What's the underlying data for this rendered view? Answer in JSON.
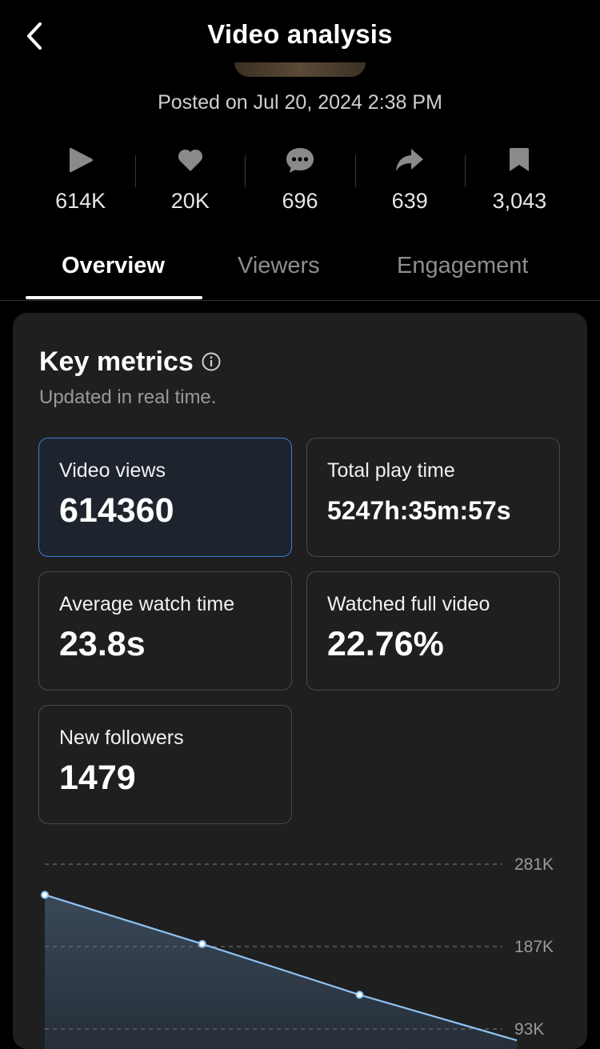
{
  "header": {
    "title": "Video analysis",
    "back_icon": "chevron-left-icon"
  },
  "posted": "Posted on Jul 20, 2024 2:38 PM",
  "stats": [
    {
      "icon": "play-icon",
      "value": "614K"
    },
    {
      "icon": "heart-icon",
      "value": "20K"
    },
    {
      "icon": "comment-icon",
      "value": "696"
    },
    {
      "icon": "share-icon",
      "value": "639"
    },
    {
      "icon": "bookmark-icon",
      "value": "3,043"
    }
  ],
  "tabs": [
    {
      "label": "Overview",
      "active": true
    },
    {
      "label": "Viewers",
      "active": false
    },
    {
      "label": "Engagement",
      "active": false
    }
  ],
  "key_metrics": {
    "title": "Key metrics",
    "subtitle": "Updated in real time.",
    "items": [
      {
        "label": "Video views",
        "value": "614360",
        "selected": true
      },
      {
        "label": "Total play time",
        "value": "5247h:35m:57s"
      },
      {
        "label": "Average watch time",
        "value": "23.8s"
      },
      {
        "label": "Watched full video",
        "value": "22.76%"
      },
      {
        "label": "New followers",
        "value": "1479"
      }
    ]
  },
  "colors": {
    "accent": "#3d7ed6",
    "line": "#8fc4f5",
    "card_bg": "#1f1f1f"
  },
  "chart_data": {
    "type": "area",
    "yticks": [
      "281K",
      "187K",
      "93K"
    ],
    "ytick_values": [
      281000,
      187000,
      93000
    ],
    "ylim": [
      0,
      281000
    ],
    "points": [
      {
        "x": 0,
        "y": 246000
      },
      {
        "x": 1,
        "y": 190000
      },
      {
        "x": 2,
        "y": 132000
      },
      {
        "x": 3,
        "y": 80000
      }
    ],
    "xlim": [
      0,
      3.05
    ],
    "grid": true
  }
}
